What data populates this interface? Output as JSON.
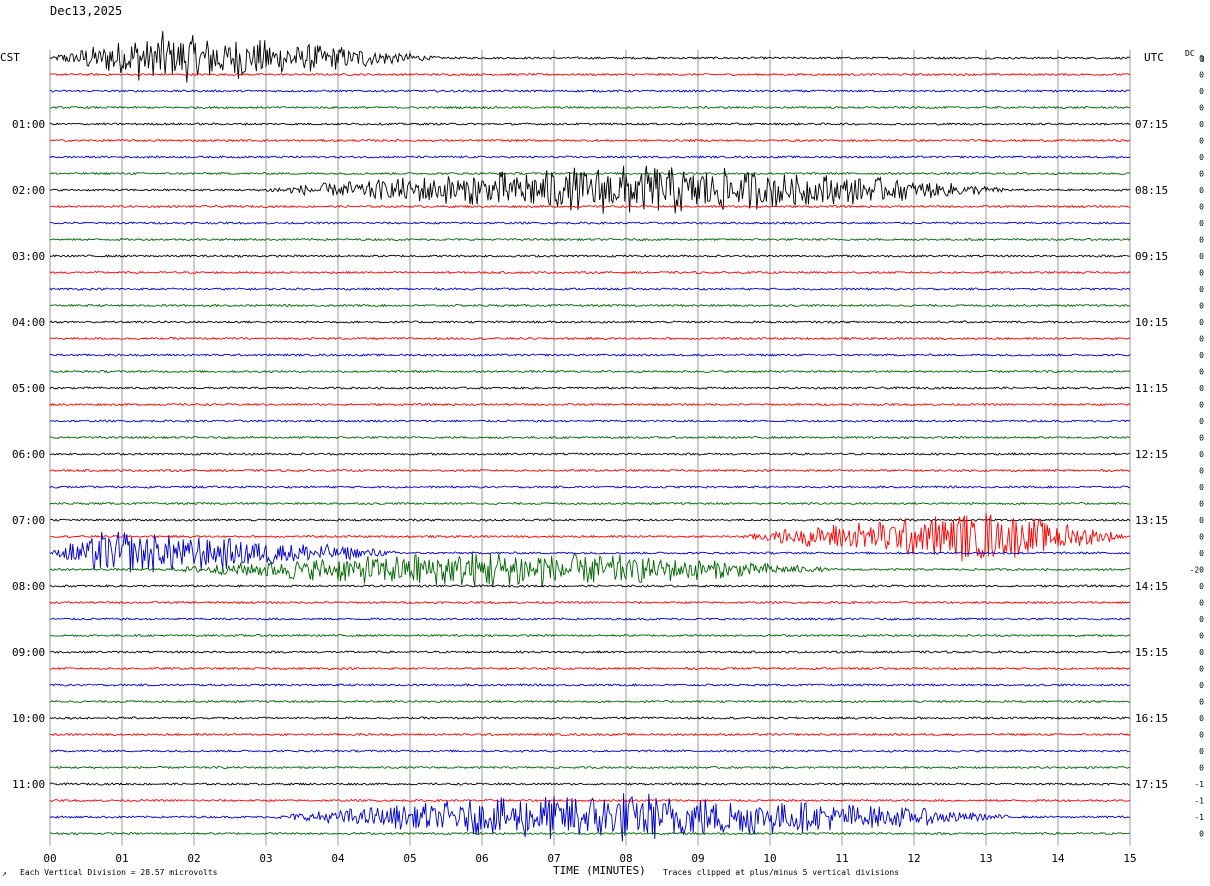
{
  "header": {
    "date": "Dec13,2025",
    "left_tz": "CST",
    "right_tz": "UTC",
    "dc_label": "DC",
    "dc_value": "3"
  },
  "footer": {
    "scale_note": "Each Vertical Division =   28.57 microvolts",
    "xlabel": "TIME (MINUTES)",
    "clip_note": "Traces clipped at plus/minus 5 vertical divisions"
  },
  "colors": {
    "black": "#000000",
    "red": "#ff0000",
    "blue": "#0000cc",
    "green": "#006600",
    "grid": "#808080"
  },
  "chart_data": {
    "type": "line",
    "title": "",
    "xlabel": "TIME (MINUTES)",
    "ylabel": "",
    "xlim": [
      0,
      15
    ],
    "x_ticks": [
      "00",
      "01",
      "02",
      "03",
      "04",
      "05",
      "06",
      "07",
      "08",
      "09",
      "10",
      "11",
      "12",
      "13",
      "14",
      "15"
    ],
    "trace_count": 48,
    "trace_color_cycle": [
      "black",
      "red",
      "blue",
      "green"
    ],
    "left_hour_labels": [
      "",
      "01:00",
      "02:00",
      "03:00",
      "04:00",
      "05:00",
      "06:00",
      "07:00",
      "08:00",
      "09:00",
      "10:00",
      "11:00"
    ],
    "right_hour_labels": [
      "",
      "07:15",
      "08:15",
      "09:15",
      "10:15",
      "11:15",
      "12:15",
      "13:15",
      "14:15",
      "15:15",
      "16:15",
      "17:15"
    ],
    "dc_offsets": [
      "0",
      "0",
      "0",
      "0",
      "0",
      "0",
      "0",
      "0",
      "0",
      "0",
      "0",
      "0",
      "0",
      "0",
      "0",
      "0",
      "0",
      "0",
      "0",
      "0",
      "0",
      "0",
      "0",
      "0",
      "0",
      "0",
      "0",
      "0",
      "0",
      "0",
      "0",
      "-20",
      "0",
      "0",
      "0",
      "0",
      "0",
      "0",
      "0",
      "0",
      "0",
      "0",
      "0",
      "0",
      "-1",
      "-1",
      "-1",
      "0"
    ],
    "events": [
      {
        "trace": 0,
        "start_min": 0,
        "end_min": 5.5,
        "peak_min": 1.5,
        "amplitude": 5.0
      },
      {
        "trace": 8,
        "start_min": 2.8,
        "end_min": 13.5,
        "peak_min": 8.3,
        "amplitude": 5.0
      },
      {
        "trace": 29,
        "start_min": 9.5,
        "end_min": 15,
        "peak_min": 13.0,
        "amplitude": 5.0
      },
      {
        "trace": 30,
        "start_min": 0,
        "end_min": 5.0,
        "peak_min": 0.8,
        "amplitude": 4.5
      },
      {
        "trace": 31,
        "start_min": 1.5,
        "end_min": 11.0,
        "peak_min": 6.2,
        "amplitude": 4.0
      },
      {
        "trace": 46,
        "start_min": 3.0,
        "end_min": 13.5,
        "peak_min": 7.8,
        "amplitude": 5.0
      }
    ]
  }
}
